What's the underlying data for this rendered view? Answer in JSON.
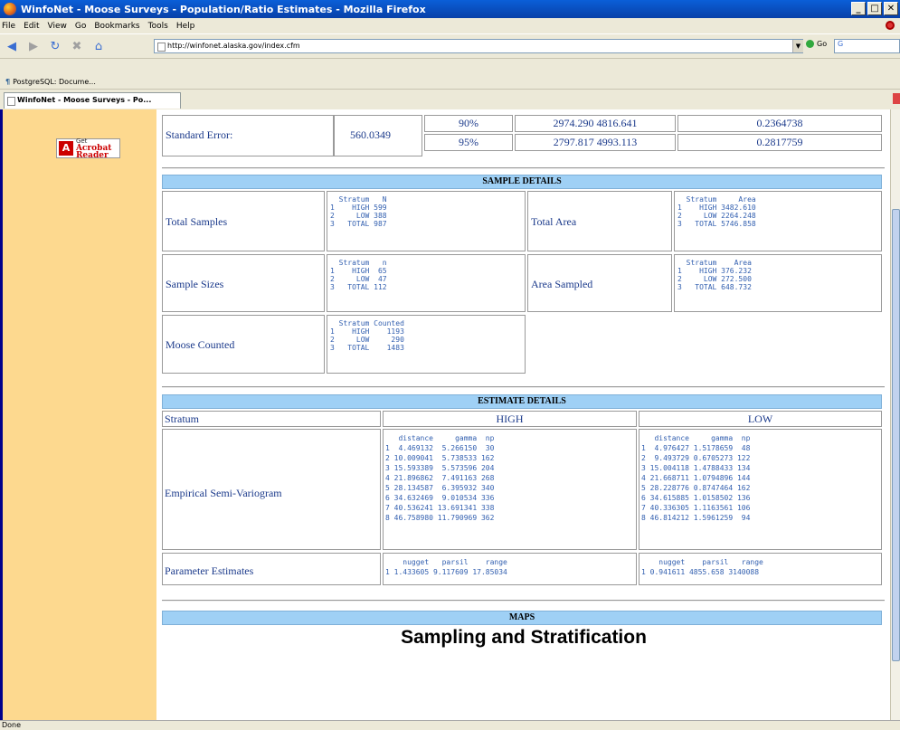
{
  "window": {
    "title": "WinfoNet - Moose Surveys - Population/Ratio Estimates - Mozilla Firefox"
  },
  "menu": [
    "File",
    "Edit",
    "View",
    "Go",
    "Bookmarks",
    "Tools",
    "Help"
  ],
  "url": "http://winfonet.alaska.gov/index.cfm",
  "go_label": "Go",
  "bookmark": "PostgreSQL: Docume...",
  "tab_title": "WinfoNet - Moose Surveys - Po...",
  "status": "Done",
  "acrobat": {
    "get": "Get",
    "name": "Acrobat",
    "reader": "Reader"
  },
  "standard_error": {
    "label": "Standard Error:",
    "value": "560.0349",
    "rows": [
      {
        "pct": "90%",
        "interval": "2974.290 4816.641",
        "ratio": "0.2364738"
      },
      {
        "pct": "95%",
        "interval": "2797.817 4993.113",
        "ratio": "0.2817759"
      }
    ]
  },
  "sample_details": {
    "header": "SAMPLE DETAILS",
    "total_samples": {
      "label": "Total Samples",
      "table": "  Stratum   N\n1    HIGH 599\n2     LOW 388\n3   TOTAL 987"
    },
    "total_area": {
      "label": "Total Area",
      "table": "  Stratum     Area\n1    HIGH 3482.610\n2     LOW 2264.248\n3   TOTAL 5746.858"
    },
    "sample_sizes": {
      "label": "Sample Sizes",
      "table": "  Stratum   n\n1    HIGH  65\n2     LOW  47\n3   TOTAL 112"
    },
    "area_sampled": {
      "label": "Area Sampled",
      "table": "  Stratum    Area\n1    HIGH 376.232\n2     LOW 272.500\n3   TOTAL 648.732"
    },
    "moose_counted": {
      "label": "Moose Counted",
      "table": "  Stratum Counted\n1    HIGH    1193\n2     LOW     290\n3   TOTAL    1483"
    }
  },
  "estimate_details": {
    "header": "ESTIMATE DETAILS",
    "stratum_label": "Stratum",
    "high": "HIGH",
    "low": "LOW",
    "variogram_label": "Empirical Semi-Variogram",
    "variogram_high": "   distance     gamma  np\n1  4.469132  5.266150  30\n2 10.009041  5.738533 162\n3 15.593389  5.573596 204\n4 21.896862  7.491163 268\n5 28.134587  6.395932 340\n6 34.632469  9.010534 336\n7 40.536241 13.691341 338\n8 46.758980 11.790969 362",
    "variogram_low": "   distance     gamma  np\n1  4.976427 1.5178659  48\n2  9.493729 0.6705273 122\n3 15.004118 1.4788433 134\n4 21.668711 1.0794896 144\n5 28.228776 0.8747464 162\n6 34.615885 1.0158502 136\n7 40.336305 1.1163561 106\n8 46.814212 1.5961259  94",
    "param_label": "Parameter Estimates",
    "param_high": "    nugget   parsil    range\n1 1.433605 9.117609 17.85034",
    "param_low": "    nugget    parsil   range\n1 0.941611 4855.658 3140088"
  },
  "maps": {
    "header": "MAPS",
    "title": "Sampling and Stratification"
  }
}
